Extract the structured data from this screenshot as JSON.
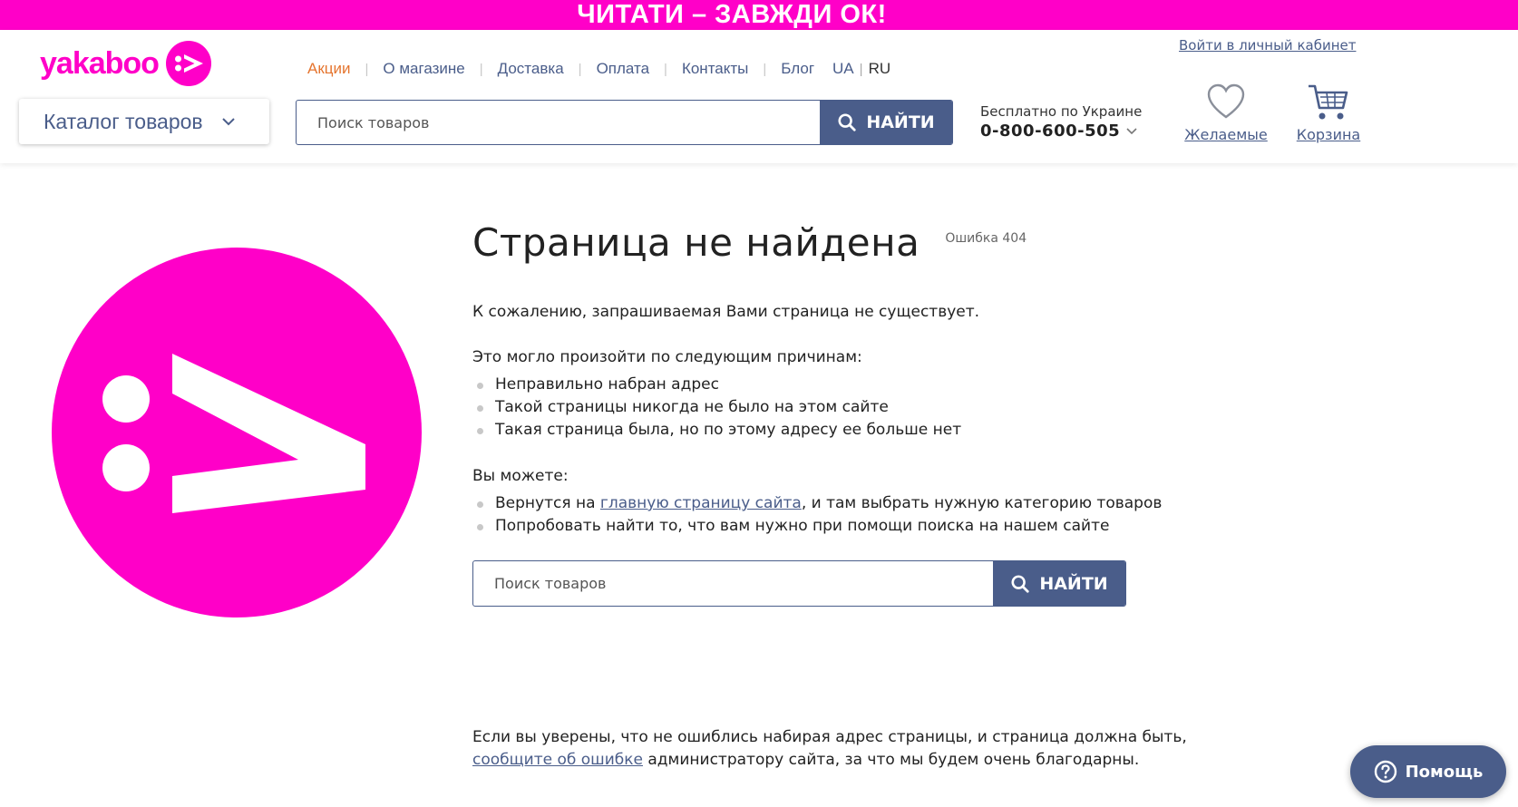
{
  "promo": {
    "text": "ЧИТАТИ – ЗАВЖДИ ОК!"
  },
  "brand": {
    "name": "yakaboo",
    "color": "#ff00c8"
  },
  "header": {
    "login_link": "Войти в личный кабинет",
    "nav": [
      {
        "label": "Акции",
        "active": true
      },
      {
        "label": "О магазине"
      },
      {
        "label": "Доставка"
      },
      {
        "label": "Оплата"
      },
      {
        "label": "Контакты"
      },
      {
        "label": "Блог"
      }
    ],
    "languages": [
      "UA",
      "RU"
    ],
    "current_language": "RU",
    "catalog_label": "Каталог товаров",
    "search": {
      "placeholder": "Поиск товаров",
      "button": "НАЙТИ",
      "icon": "search-icon"
    },
    "phone": {
      "caption": "Бесплатно по Украине",
      "number": "0-800-600-505"
    },
    "wishlist_label": "Желаемые",
    "cart_label": "Корзина"
  },
  "main": {
    "title": "Страница не найдена",
    "error_code": "Ошибка 404",
    "intro": "К сожалению, запрашиваемая Вами страница не существует.",
    "reasons_heading": "Это могло произойти по следующим причинам:",
    "reasons": [
      "Неправильно набран адрес",
      "Такой страницы никогда не было на этом сайте",
      "Такая страница была, но по этому адресу ее больше нет"
    ],
    "options_heading": "Вы можете:",
    "option1_before": "Вернутся на ",
    "option1_link": "главную страницу сайта",
    "option1_after": ", и там выбрать нужную категорию товаров",
    "option2": "Попробовать найти то, что вам нужно при помощи поиска на нашем сайте",
    "search": {
      "placeholder": "Поиск товаров",
      "button": "НАЙТИ"
    },
    "footer_line1": "Если вы уверены, что не ошиблись набирая адрес страницы, и страница должна быть,",
    "footer_link": "сообщите об ошибке",
    "footer_line2_after": " администратору сайта, за что мы будем очень благодарны."
  },
  "help": {
    "label": "Помощь"
  },
  "colors": {
    "accent": "#ff00c8",
    "primary": "#4a5d8a",
    "nav_active": "#e5752f"
  }
}
